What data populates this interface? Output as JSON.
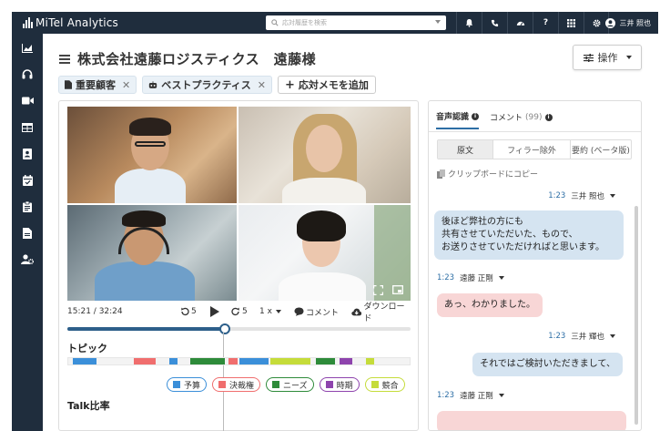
{
  "topbar": {
    "logo_text": "MiTel Analytics",
    "search_placeholder": "応対履歴を検索",
    "icons": [
      "bell-icon",
      "phone-icon",
      "dashboard-icon",
      "help-icon",
      "grid-icon",
      "gear-icon"
    ],
    "help_glyph": "?",
    "user_name": "三井 照也"
  },
  "sidebar": {
    "items": [
      "chart-icon",
      "headset-icon",
      "video-icon",
      "table-icon",
      "contact-icon",
      "calendar-icon",
      "clipboard-icon",
      "document-icon",
      "user-settings-icon"
    ]
  },
  "header": {
    "title": "株式会社遠藤ロジスティクス　遠藤様",
    "operation_label": "操作"
  },
  "tags": [
    {
      "label": "重要顧客",
      "icon": "document-icon"
    },
    {
      "label": "ベストプラクティス",
      "icon": "robot-icon"
    }
  ],
  "add_memo_label": "応対メモを追加",
  "player": {
    "time": "15:21 / 32:24",
    "rewind_label": "5",
    "forward_label": "5",
    "speed": "1 x",
    "comment_label": "コメント",
    "download_label": "ダウンロード",
    "progress": 0.46
  },
  "topics": {
    "title": "トピック",
    "legend": [
      {
        "label": "予算",
        "color": "#3b8fd9",
        "border": "#3b8fd9"
      },
      {
        "label": "決裁権",
        "color": "#f06e6e",
        "border": "#f06e6e"
      },
      {
        "label": "ニーズ",
        "color": "#2e8b3a",
        "border": "#2e8b3a"
      },
      {
        "label": "時期",
        "color": "#8e44ad",
        "border": "#8e44ad"
      },
      {
        "label": "競合",
        "color": "#c5dc3a",
        "border": "#c5dc3a"
      }
    ]
  },
  "talk_ratio_title": "Talk比率",
  "transcript": {
    "tab_voice": "音声認識",
    "tab_comments": "コメント",
    "comment_count": "(99)",
    "modes": [
      "原文",
      "フィラー除外",
      "要約 (ベータ版)"
    ],
    "copy_label": "クリップボードにコピー",
    "messages": [
      {
        "time": "1:23",
        "speaker": "三井 照也",
        "text_lines": [
          "後ほど弊社の方にも",
          "共有させていただいた、もので、",
          "お送りさせていただければと思います。"
        ],
        "color": "blue"
      },
      {
        "time": "1:23",
        "speaker": "遠藤 正剛",
        "text_lines": [
          "あっ、わかりました。"
        ],
        "color": "pink"
      },
      {
        "time": "1:23",
        "speaker": "三井 輝也",
        "text_lines": [
          "それではご検討いただきまして、"
        ],
        "color": "blue"
      },
      {
        "time": "1:23",
        "speaker": "遠藤 正剛",
        "text_lines": [],
        "color": "pink"
      }
    ]
  },
  "colors": {
    "nav_bg": "#1f2d3d",
    "accent": "#2d6ea5"
  }
}
